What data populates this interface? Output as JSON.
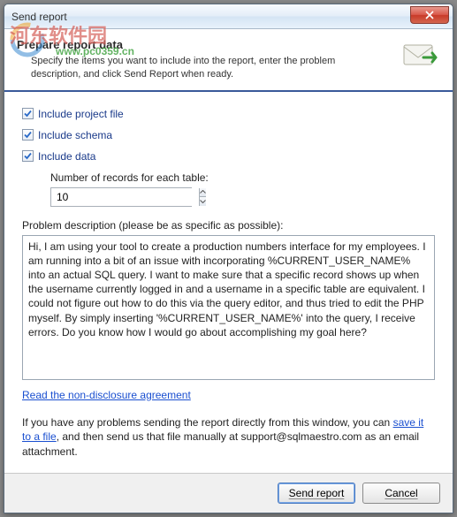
{
  "window": {
    "title": "Send report"
  },
  "header": {
    "title": "Prepare report data",
    "description": "Specify the items you want to include into the report, enter the problem description, and click Send Report when ready."
  },
  "watermark": {
    "text": "河东软件园",
    "url": "www.pc0359.cn"
  },
  "checkboxes": {
    "include_project_file": {
      "label": "Include project file",
      "checked": true
    },
    "include_schema": {
      "label": "Include schema",
      "checked": true
    },
    "include_data": {
      "label": "Include data",
      "checked": true
    }
  },
  "records": {
    "label": "Number of records for each table:",
    "value": "10"
  },
  "problem": {
    "label": "Problem description (please be as specific as possible):",
    "value": "Hi, I am using your tool to create a production numbers interface for my employees. I am running into a bit of an issue with incorporating %CURRENT_USER_NAME% into an actual SQL query. I want to make sure that a specific record shows up when the username currently logged in and a username in a specific table are equivalent. I could not figure out how to do this via the query editor, and thus tried to edit the PHP myself. By simply inserting '%CURRENT_USER_NAME%' into the query, I receive errors. Do you know how I would go about accomplishing my goal here?"
  },
  "nda": {
    "link": "Read the non-disclosure agreement"
  },
  "help": {
    "prefix": "If you have any problems sending the report directly from this window, you can ",
    "link": "save it to a file",
    "suffix": ", and then send us that file manually at support@sqlmaestro.com as an email attachment."
  },
  "buttons": {
    "send": "Send report",
    "cancel": "Cancel"
  }
}
